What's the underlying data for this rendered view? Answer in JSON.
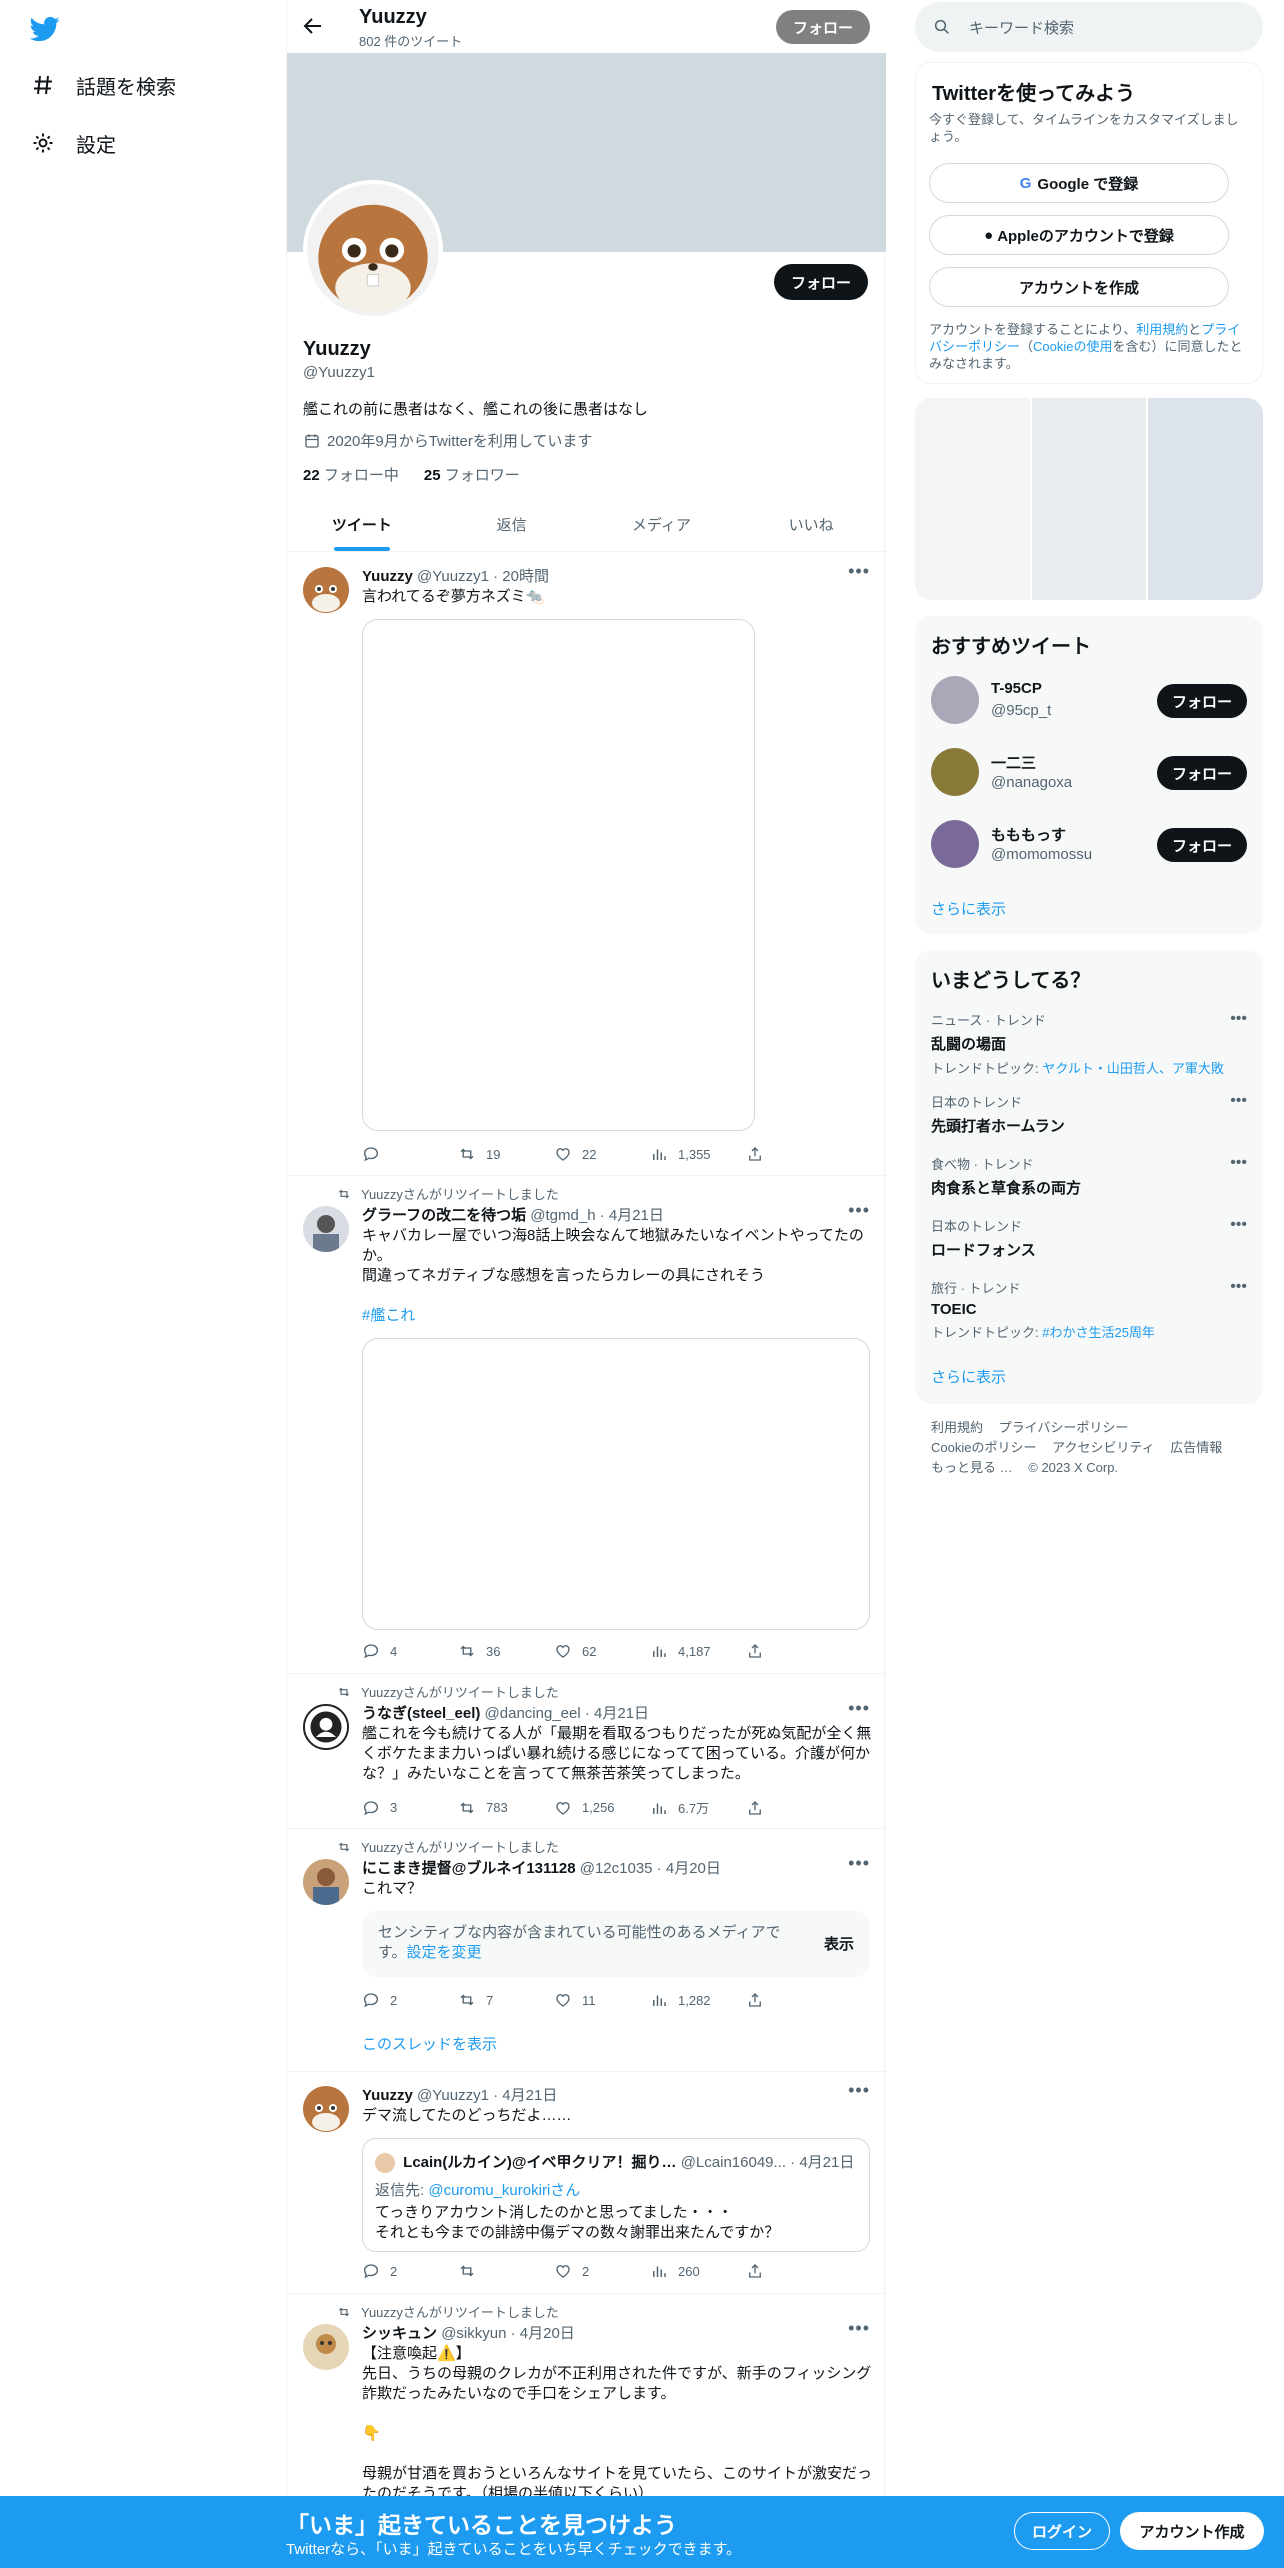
{
  "nav": {
    "explore_label": "話題を検索",
    "settings_label": "設定"
  },
  "header": {
    "name": "Yuuzzy",
    "tweet_count": "802 件のツイート",
    "follow_label": "フォロー"
  },
  "profile": {
    "name": "Yuuzzy",
    "handle": "@Yuuzzy1",
    "bio": "艦これの前に愚者はなく、艦これの後に愚者はなし",
    "joined": "2020年9月からTwitterを利用しています",
    "following_count": "22",
    "following_label": "フォロー中",
    "followers_count": "25",
    "followers_label": "フォロワー",
    "follow_label": "フォロー"
  },
  "tabs": [
    "ツイート",
    "返信",
    "メディア",
    "いいね"
  ],
  "tweets": [
    {
      "name": "Yuuzzy",
      "meta": "@Yuuzzy1 · 20時間",
      "text": "言われてるぞ夢方ネズミ🐀",
      "reply": "",
      "retweet": "19",
      "like": "22",
      "views": "1,355"
    },
    {
      "rt_label": "Yuuzzyさんがリツイートしました",
      "name": "グラーフの改二を待つ垢",
      "meta": "@tgmd_h · 4月21日",
      "text1": "キャバカレー屋でいつ海8話上映会なんて地獄みたいなイベントやってたのか。",
      "text2": "間違ってネガティブな感想を言ったらカレーの具にされそう",
      "hashtag": "#艦これ",
      "reply": "4",
      "retweet": "36",
      "like": "62",
      "views": "4,187"
    },
    {
      "rt_label": "Yuuzzyさんがリツイートしました",
      "name": "うなぎ(steel_eel)",
      "meta": "@dancing_eel · 4月21日",
      "text": "艦これを今も続けてる人が「最期を看取るつもりだったが死ぬ気配が全く無くボケたまま力いっぱい暴れ続ける感じになってて困っている。介護が何かな？」みたいなことを言ってて無茶苦茶笑ってしまった。",
      "reply": "3",
      "retweet": "783",
      "like": "1,256",
      "views": "6.7万"
    },
    {
      "rt_label": "Yuuzzyさんがリツイートしました",
      "name": "にこまき提督@ブルネイ131128",
      "meta": "@12c1035 · 4月20日",
      "text": "これマ？",
      "sensitive_text": "センシティブな内容が含まれている可能性のあるメディアです。",
      "sensitive_link": "設定を変更",
      "show_label": "表示",
      "reply": "2",
      "retweet": "7",
      "like": "11",
      "views": "1,282",
      "thread_link": "このスレッドを表示"
    },
    {
      "name": "Yuuzzy",
      "meta": "@Yuuzzy1 · 4月21日",
      "text": "デマ流してたのどっちだよ……",
      "quote_name": "Lcain(ルカイン)@イベ甲クリア！掘り…",
      "quote_meta": "@Lcain16049... · 4月21日",
      "quote_reply_prefix": "返信先: ",
      "quote_reply_to": "@curomu_kurokiriさん",
      "quote_text1": "てっきりアカウント消したのかと思ってました・・・",
      "quote_text2": "それとも今までの誹謗中傷デマの数々謝罪出来たんですか？",
      "reply": "2",
      "retweet": "",
      "like": "2",
      "views": "260"
    },
    {
      "rt_label": "Yuuzzyさんがリツイートしました",
      "name": "シッキュン",
      "meta": "@sikkyun · 4月20日",
      "text1": "【注意喚起⚠️】",
      "text2": "先日、うちの母親のクレカが不正利用された件ですが、新手のフィッシング詐欺だったみたいなので手口をシェアします。",
      "text3": "👇",
      "text4": "母親が甘酒を買おうといろんなサイトを見ていたら、このサイトが激安だったのだそうです。（相場の半値以下くらい）"
    }
  ],
  "right": {
    "search_placeholder": "キーワード検索",
    "signup_title": "Twitterを使ってみよう",
    "signup_sub": "今すぐ登録して、タイムラインをカスタマイズしましょう。",
    "google_label": "Google で登録",
    "apple_label": "Appleのアカウントで登録",
    "create_label": "アカウントを作成",
    "terms_prefix": "アカウントを登録することにより、",
    "terms_link": "利用規約",
    "terms_and": "と",
    "privacy_link": "プライバシーポリシー",
    "cookie_open": "（",
    "cookie_link": "Cookieの使用",
    "cookie_suffix": "を含む）に同意したとみなされます。",
    "rec_title": "おすすめツイート",
    "rec_users": [
      {
        "name": "T-95CP",
        "handle": "@95cp_t",
        "btn": "フォロー"
      },
      {
        "name": "一二三",
        "handle": "@nanagoxa",
        "btn": "フォロー"
      },
      {
        "name": "もももっす",
        "handle": "@momomossu",
        "btn": "フォロー"
      }
    ],
    "show_more": "さらに表示",
    "trends_title": "いまどうしてる？",
    "trends": [
      {
        "cat": "ニュース · トレンド",
        "name": "乱闘の場面",
        "topic_prefix": "トレンドトピック: ",
        "topic": "ヤクルト・山田哲人、ア軍大敗"
      },
      {
        "cat": "日本のトレンド",
        "name": "先頭打者ホームラン",
        "topic_prefix": "",
        "topic": ""
      },
      {
        "cat": "食べ物 · トレンド",
        "name": "肉食系と草食系の両方",
        "topic_prefix": "",
        "topic": ""
      },
      {
        "cat": "日本のトレンド",
        "name": "ロードフォンス",
        "topic_prefix": "",
        "topic": ""
      },
      {
        "cat": "旅行 · トレンド",
        "name": "TOEIC",
        "topic_prefix": "トレンドトピック: ",
        "topic": "#わかさ生活25周年"
      }
    ],
    "trends_more": "さらに表示",
    "footer": {
      "terms": "利用規約",
      "privacy": "プライバシーポリシー",
      "cookie": "Cookieのポリシー",
      "accessibility": "アクセシビリティ",
      "ads": "広告情報",
      "more": "もっと見る …",
      "copyright": "© 2023 X Corp."
    }
  },
  "bottom": {
    "title": "「いま」起きていることを見つけよう",
    "subtitle": "Twitterなら、「いま」起きていることをいち早くチェックできます。",
    "login": "ログイン",
    "signup": "アカウント作成"
  },
  "colors": {
    "accent": "#1d9bf0",
    "text": "#0f1419",
    "muted": "#536471",
    "panel": "#f7f9f9"
  }
}
